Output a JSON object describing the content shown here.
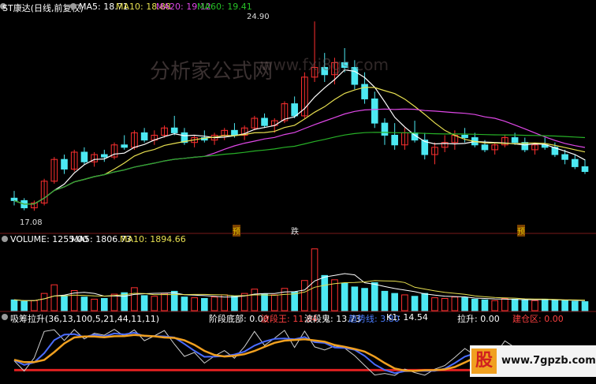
{
  "colors": {
    "bg": "#000000",
    "up": "#ff3030",
    "down": "#4ce8f2",
    "ma5": "#ffffff",
    "ma10": "#e8e050",
    "ma20": "#e048e8",
    "ma60": "#27b127",
    "divider": "#7a1a1a",
    "watermark": "#6b5a5a"
  },
  "price_panel": {
    "title": "ST康达(日线,前复权)",
    "ma5": "MA5: 18.71",
    "ma10": "MA10: 18.88",
    "ma20": "MA20: 19.12",
    "ma60": "MA60: 19.41",
    "high_label": "24.90",
    "low_label": "17.08",
    "markers": [
      "预",
      "跌",
      "预"
    ]
  },
  "volume_panel": {
    "volume": "VOLUME: 1255.00",
    "ma5": "MA5: 1806.73",
    "ma10": "MA10: 1894.66"
  },
  "indicator_panel": {
    "name": "吸筹拉升(36,13,100,5,21,44,11,11)",
    "stage_bottom": "阶段底部: 0.00",
    "wave_king": "波段王: 11.84",
    "wave_ghost": "波段鬼: 13.73",
    "trend_line": "趋势线: 3.80",
    "k1": "K1: 14.54",
    "lift": "拉升: 0.00",
    "accumulate": "建仓区: 0.00"
  },
  "watermarks": [
    "分析家公式网",
    "www.fxj8gs.com"
  ],
  "site_badge": "www.7gpzb.com",
  "chart_data": {
    "type": "candlestick",
    "ma_values": {
      "MA5": 18.71,
      "MA10": 18.88,
      "MA20": 19.12,
      "MA60": 19.41
    },
    "high": 24.9,
    "low": 17.08,
    "candles": [
      [
        17.6,
        17.9,
        17.3,
        17.5
      ],
      [
        17.5,
        17.6,
        17.1,
        17.2
      ],
      [
        17.2,
        17.5,
        17.08,
        17.4
      ],
      [
        17.4,
        18.4,
        17.3,
        18.3
      ],
      [
        18.3,
        19.3,
        18.2,
        19.2
      ],
      [
        19.2,
        19.4,
        18.6,
        18.8
      ],
      [
        18.8,
        19.6,
        18.7,
        19.5
      ],
      [
        19.5,
        19.7,
        19.0,
        19.1
      ],
      [
        19.1,
        19.5,
        18.9,
        19.4
      ],
      [
        19.4,
        19.6,
        19.1,
        19.3
      ],
      [
        19.3,
        19.9,
        19.2,
        19.8
      ],
      [
        19.8,
        20.2,
        19.6,
        19.7
      ],
      [
        19.7,
        20.4,
        19.6,
        20.3
      ],
      [
        20.3,
        20.5,
        19.9,
        20.0
      ],
      [
        20.0,
        20.4,
        19.8,
        20.2
      ],
      [
        20.2,
        20.6,
        20.1,
        20.5
      ],
      [
        20.5,
        21.0,
        20.2,
        20.3
      ],
      [
        20.3,
        20.5,
        19.8,
        19.9
      ],
      [
        19.9,
        20.2,
        19.7,
        20.1
      ],
      [
        20.1,
        20.4,
        19.9,
        20.0
      ],
      [
        20.0,
        20.3,
        19.8,
        20.2
      ],
      [
        20.2,
        20.5,
        20.0,
        20.4
      ],
      [
        20.4,
        20.7,
        20.1,
        20.2
      ],
      [
        20.2,
        20.6,
        20.0,
        20.5
      ],
      [
        20.5,
        21.0,
        20.4,
        20.9
      ],
      [
        20.9,
        21.1,
        20.5,
        20.6
      ],
      [
        20.6,
        20.9,
        20.3,
        20.8
      ],
      [
        20.8,
        21.6,
        20.7,
        21.5
      ],
      [
        21.5,
        21.8,
        20.9,
        21.0
      ],
      [
        21.0,
        22.8,
        20.9,
        22.6
      ],
      [
        22.6,
        24.9,
        22.4,
        23.0
      ],
      [
        23.0,
        23.6,
        22.4,
        22.7
      ],
      [
        22.7,
        23.4,
        22.3,
        23.2
      ],
      [
        23.2,
        23.8,
        22.8,
        23.0
      ],
      [
        23.0,
        23.3,
        22.1,
        22.3
      ],
      [
        22.3,
        22.8,
        21.5,
        21.7
      ],
      [
        21.7,
        22.0,
        20.5,
        20.7
      ],
      [
        20.7,
        20.9,
        19.8,
        20.2
      ],
      [
        20.2,
        20.7,
        19.6,
        19.8
      ],
      [
        19.8,
        20.5,
        19.6,
        20.3
      ],
      [
        20.3,
        20.8,
        19.9,
        20.0
      ],
      [
        20.0,
        20.3,
        19.2,
        19.4
      ],
      [
        19.4,
        19.9,
        19.0,
        19.7
      ],
      [
        19.7,
        20.2,
        19.5,
        19.9
      ],
      [
        19.9,
        20.4,
        19.6,
        20.2
      ],
      [
        20.2,
        20.5,
        19.9,
        20.1
      ],
      [
        20.1,
        20.3,
        19.7,
        19.8
      ],
      [
        19.8,
        20.0,
        19.5,
        19.6
      ],
      [
        19.6,
        19.9,
        19.4,
        19.8
      ],
      [
        19.8,
        20.2,
        19.7,
        20.1
      ],
      [
        20.1,
        20.3,
        19.8,
        19.9
      ],
      [
        19.9,
        20.1,
        19.5,
        19.6
      ],
      [
        19.6,
        19.9,
        19.4,
        19.8
      ],
      [
        19.8,
        20.1,
        19.6,
        19.7
      ],
      [
        19.7,
        19.9,
        19.3,
        19.4
      ],
      [
        19.4,
        19.6,
        19.0,
        19.2
      ],
      [
        19.2,
        19.4,
        18.8,
        18.9
      ],
      [
        18.9,
        19.2,
        18.6,
        18.7
      ]
    ],
    "volume": [
      1500,
      1300,
      1400,
      2400,
      3600,
      2100,
      2800,
      1900,
      1600,
      1700,
      2300,
      2500,
      3200,
      2100,
      2000,
      2400,
      2700,
      1900,
      1800,
      1700,
      1900,
      2200,
      2000,
      2400,
      3000,
      2300,
      2200,
      3100,
      2600,
      4200,
      8600,
      4900,
      4300,
      3800,
      3300,
      3100,
      3900,
      2700,
      2400,
      2200,
      2000,
      2400,
      1800,
      1700,
      1900,
      1800,
      1600,
      1500,
      1400,
      1700,
      1600,
      1500,
      1400,
      1600,
      1500,
      1400,
      1300,
      1255
    ]
  }
}
